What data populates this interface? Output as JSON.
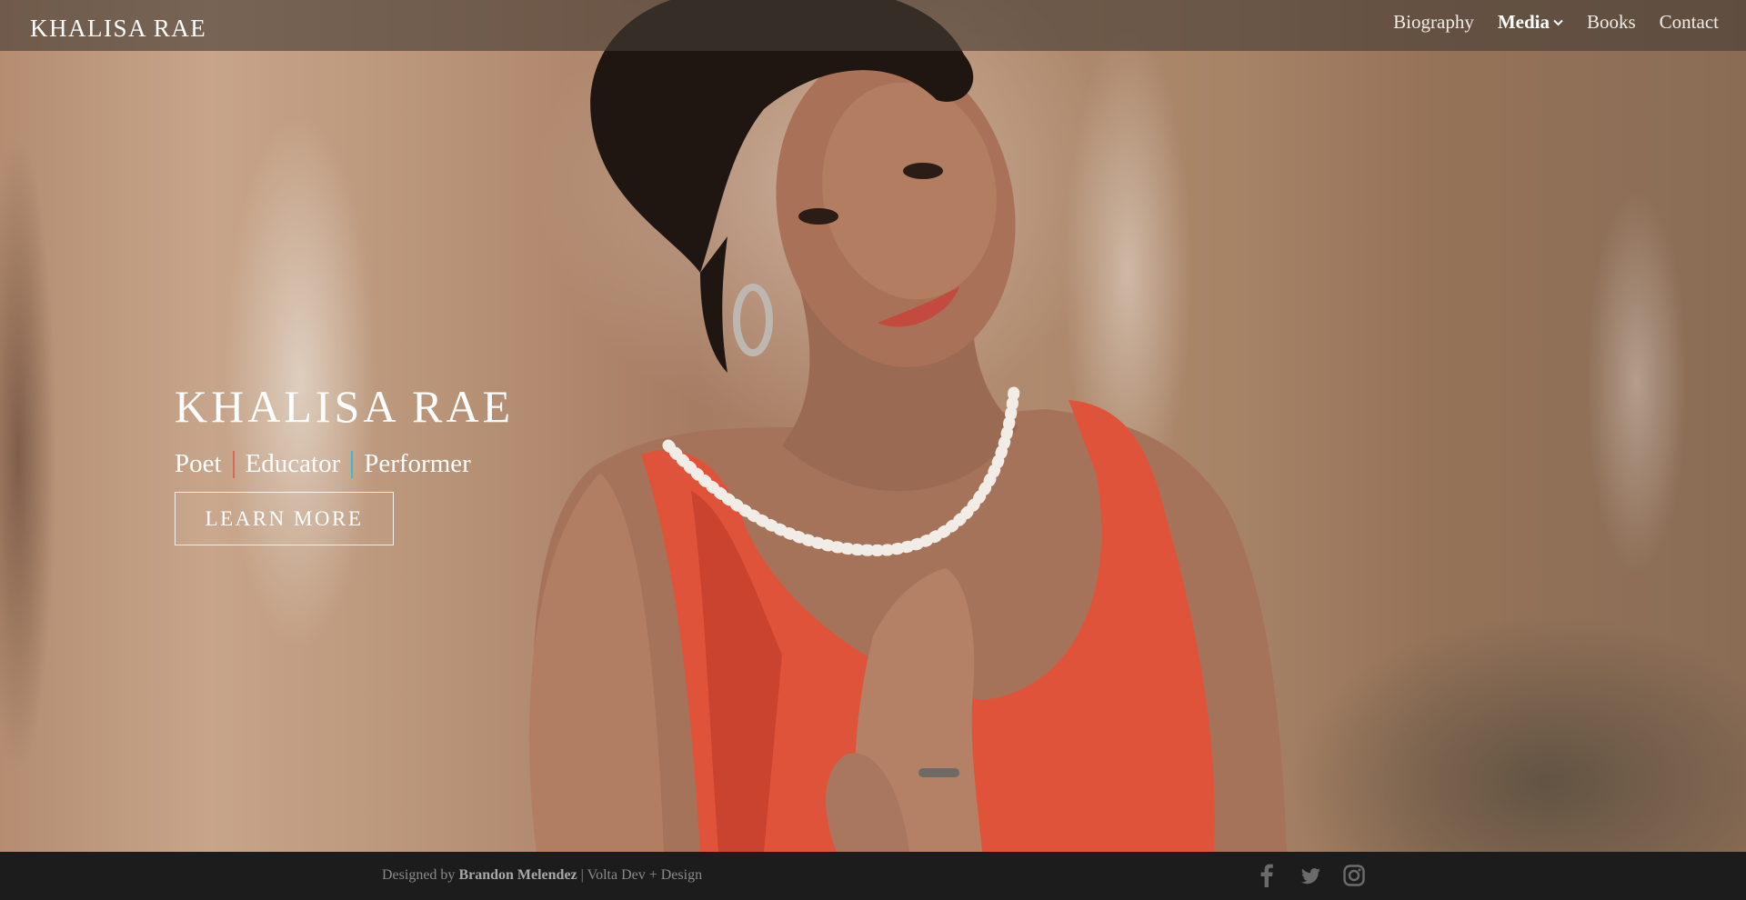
{
  "site": {
    "logo": "KHALISA RAE"
  },
  "nav": {
    "items": [
      {
        "label": "Biography",
        "active": false
      },
      {
        "label": "Media",
        "active": true,
        "has_dropdown": true
      },
      {
        "label": "Books",
        "active": false
      },
      {
        "label": "Contact",
        "active": false
      }
    ]
  },
  "hero": {
    "title": "KHALISA RAE",
    "roles": [
      "Poet",
      "Educator",
      "Performer"
    ],
    "separator_colors": [
      "#e0635a",
      "#3fb8c8"
    ],
    "cta_label": "LEARN MORE",
    "image": "portrait of woman in red top with pearl necklace"
  },
  "footer": {
    "designed_by_prefix": "Designed by",
    "designer": "Brandon Melendez",
    "separator": "|",
    "studio": "Volta Dev + Design",
    "social": [
      "facebook-icon",
      "twitter-icon",
      "instagram-icon"
    ]
  }
}
